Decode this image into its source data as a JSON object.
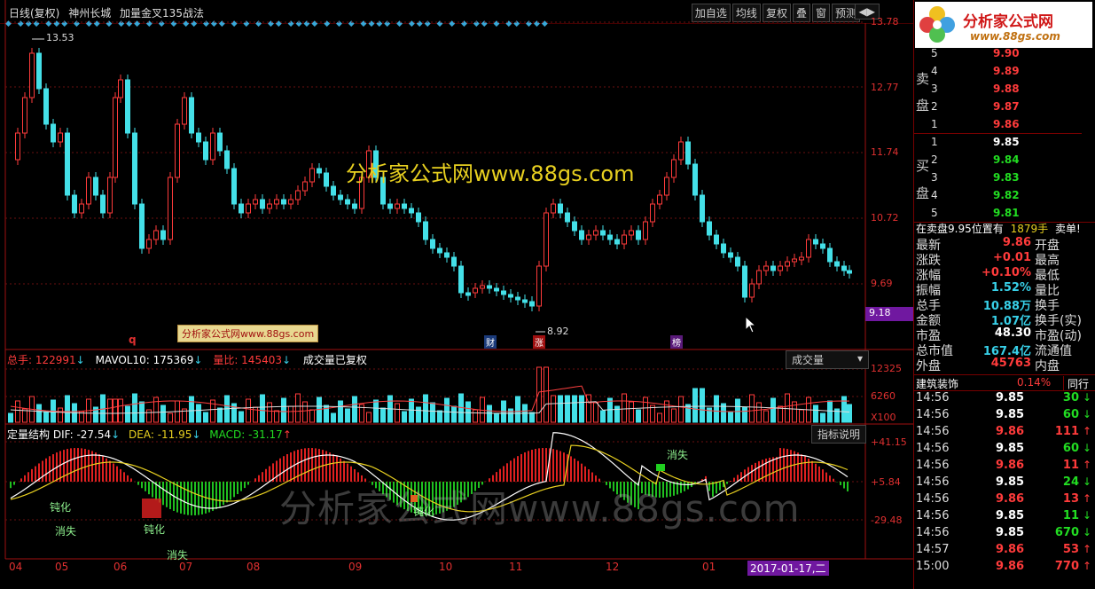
{
  "title": {
    "period": "日线(复权)",
    "stock": "神州长城",
    "formula": "加量金叉135战法"
  },
  "toolbar": [
    "加自选",
    "均线",
    "复权",
    "叠",
    "窗",
    "预测"
  ],
  "price_axis": [
    "13.78",
    "12.77",
    "11.74",
    "10.72",
    "9.69",
    "9.18"
  ],
  "high_label": "13.53",
  "low_label": "8.92",
  "event_tags": [
    "财",
    "涨",
    "榜"
  ],
  "q_mark": "q",
  "watermark_main": "分析家公式网www.88gs.com",
  "watermark_small": "分析家公式网www.88gs.com",
  "watermark_big": "分析家公式网www.88gs.com",
  "volume_panel": {
    "total_label": "总手: 122991",
    "mavol": "MAVOL10: 175369",
    "ratio": "量比: 145403",
    "note": "成交量已复权",
    "dropdown": "成交量",
    "axis": [
      "12325",
      "6260",
      "X100"
    ]
  },
  "macd_panel": {
    "name": "定量结构",
    "dif": "DIF: -27.54",
    "dea": "DEA: -11.95",
    "macd": "MACD: -31.17",
    "button": "指标说明",
    "axis": [
      "+41.15",
      "+5.84",
      "-29.48"
    ],
    "annotations": [
      "钝化",
      "消失",
      "钝化",
      "消失",
      "钝化",
      "消失"
    ]
  },
  "x_dates": [
    "04",
    "05",
    "06",
    "07",
    "08",
    "09",
    "10",
    "11",
    "12",
    "01"
  ],
  "current_date": "2017-01-17,二",
  "logo": {
    "title": "分析家公式网",
    "url": "www.88gs.com"
  },
  "sell_label": [
    "卖",
    "盘"
  ],
  "buy_label": [
    "买",
    "盘"
  ],
  "sell_orders": [
    {
      "n": "5",
      "p": "9.90"
    },
    {
      "n": "4",
      "p": "9.89"
    },
    {
      "n": "3",
      "p": "9.88"
    },
    {
      "n": "2",
      "p": "9.87"
    },
    {
      "n": "1",
      "p": "9.86"
    }
  ],
  "buy_orders": [
    {
      "n": "1",
      "p": "9.85"
    },
    {
      "n": "2",
      "p": "9.84"
    },
    {
      "n": "3",
      "p": "9.83"
    },
    {
      "n": "4",
      "p": "9.82"
    },
    {
      "n": "5",
      "p": "9.81"
    }
  ],
  "order_note": "在卖盘9.95位置有",
  "order_note_vol": "1879手",
  "order_note_tail": "卖单!",
  "stats": [
    {
      "l": "最新",
      "v": "9.86",
      "c": "red",
      "r": "开盘"
    },
    {
      "l": "涨跌",
      "v": "+0.01",
      "c": "red",
      "r": "最高"
    },
    {
      "l": "涨幅",
      "v": "+0.10%",
      "c": "red",
      "r": "最低"
    },
    {
      "l": "振幅",
      "v": "1.52%",
      "c": "cyn",
      "r": "量比"
    },
    {
      "l": "总手",
      "v": "10.88万",
      "c": "cyn",
      "r": "换手"
    },
    {
      "l": "金额",
      "v": "1.07亿",
      "c": "cyn",
      "r": "换手(实)"
    },
    {
      "l": "市盈",
      "v": "48.30",
      "c": "wht",
      "r": "市盈(动)"
    },
    {
      "l": "总市值",
      "v": "167.4亿",
      "c": "cyn",
      "r": "流通值"
    },
    {
      "l": "外盘",
      "v": "45763",
      "c": "red",
      "r": "内盘"
    }
  ],
  "industry": {
    "name": "建筑装饰",
    "pct": "0.14%",
    "tab": "同行"
  },
  "ticks": [
    {
      "t": "14:56",
      "p": "9.85",
      "pc": "wht",
      "v": "30",
      "vc": "grn",
      "a": "down"
    },
    {
      "t": "14:56",
      "p": "9.85",
      "pc": "wht",
      "v": "60",
      "vc": "grn",
      "a": "down"
    },
    {
      "t": "14:56",
      "p": "9.86",
      "pc": "red",
      "v": "111",
      "vc": "red",
      "a": "up"
    },
    {
      "t": "14:56",
      "p": "9.85",
      "pc": "wht",
      "v": "60",
      "vc": "grn",
      "a": "down"
    },
    {
      "t": "14:56",
      "p": "9.86",
      "pc": "red",
      "v": "11",
      "vc": "red",
      "a": "up"
    },
    {
      "t": "14:56",
      "p": "9.85",
      "pc": "wht",
      "v": "24",
      "vc": "grn",
      "a": "down"
    },
    {
      "t": "14:56",
      "p": "9.86",
      "pc": "red",
      "v": "13",
      "vc": "red",
      "a": "up"
    },
    {
      "t": "14:56",
      "p": "9.85",
      "pc": "wht",
      "v": "11",
      "vc": "grn",
      "a": "down"
    },
    {
      "t": "14:56",
      "p": "9.85",
      "pc": "wht",
      "v": "670",
      "vc": "grn",
      "a": "down"
    },
    {
      "t": "14:57",
      "p": "9.86",
      "pc": "red",
      "v": "53",
      "vc": "red",
      "a": "up"
    },
    {
      "t": "15:00",
      "p": "9.86",
      "pc": "red",
      "v": "770",
      "vc": "red",
      "a": "up"
    }
  ]
}
